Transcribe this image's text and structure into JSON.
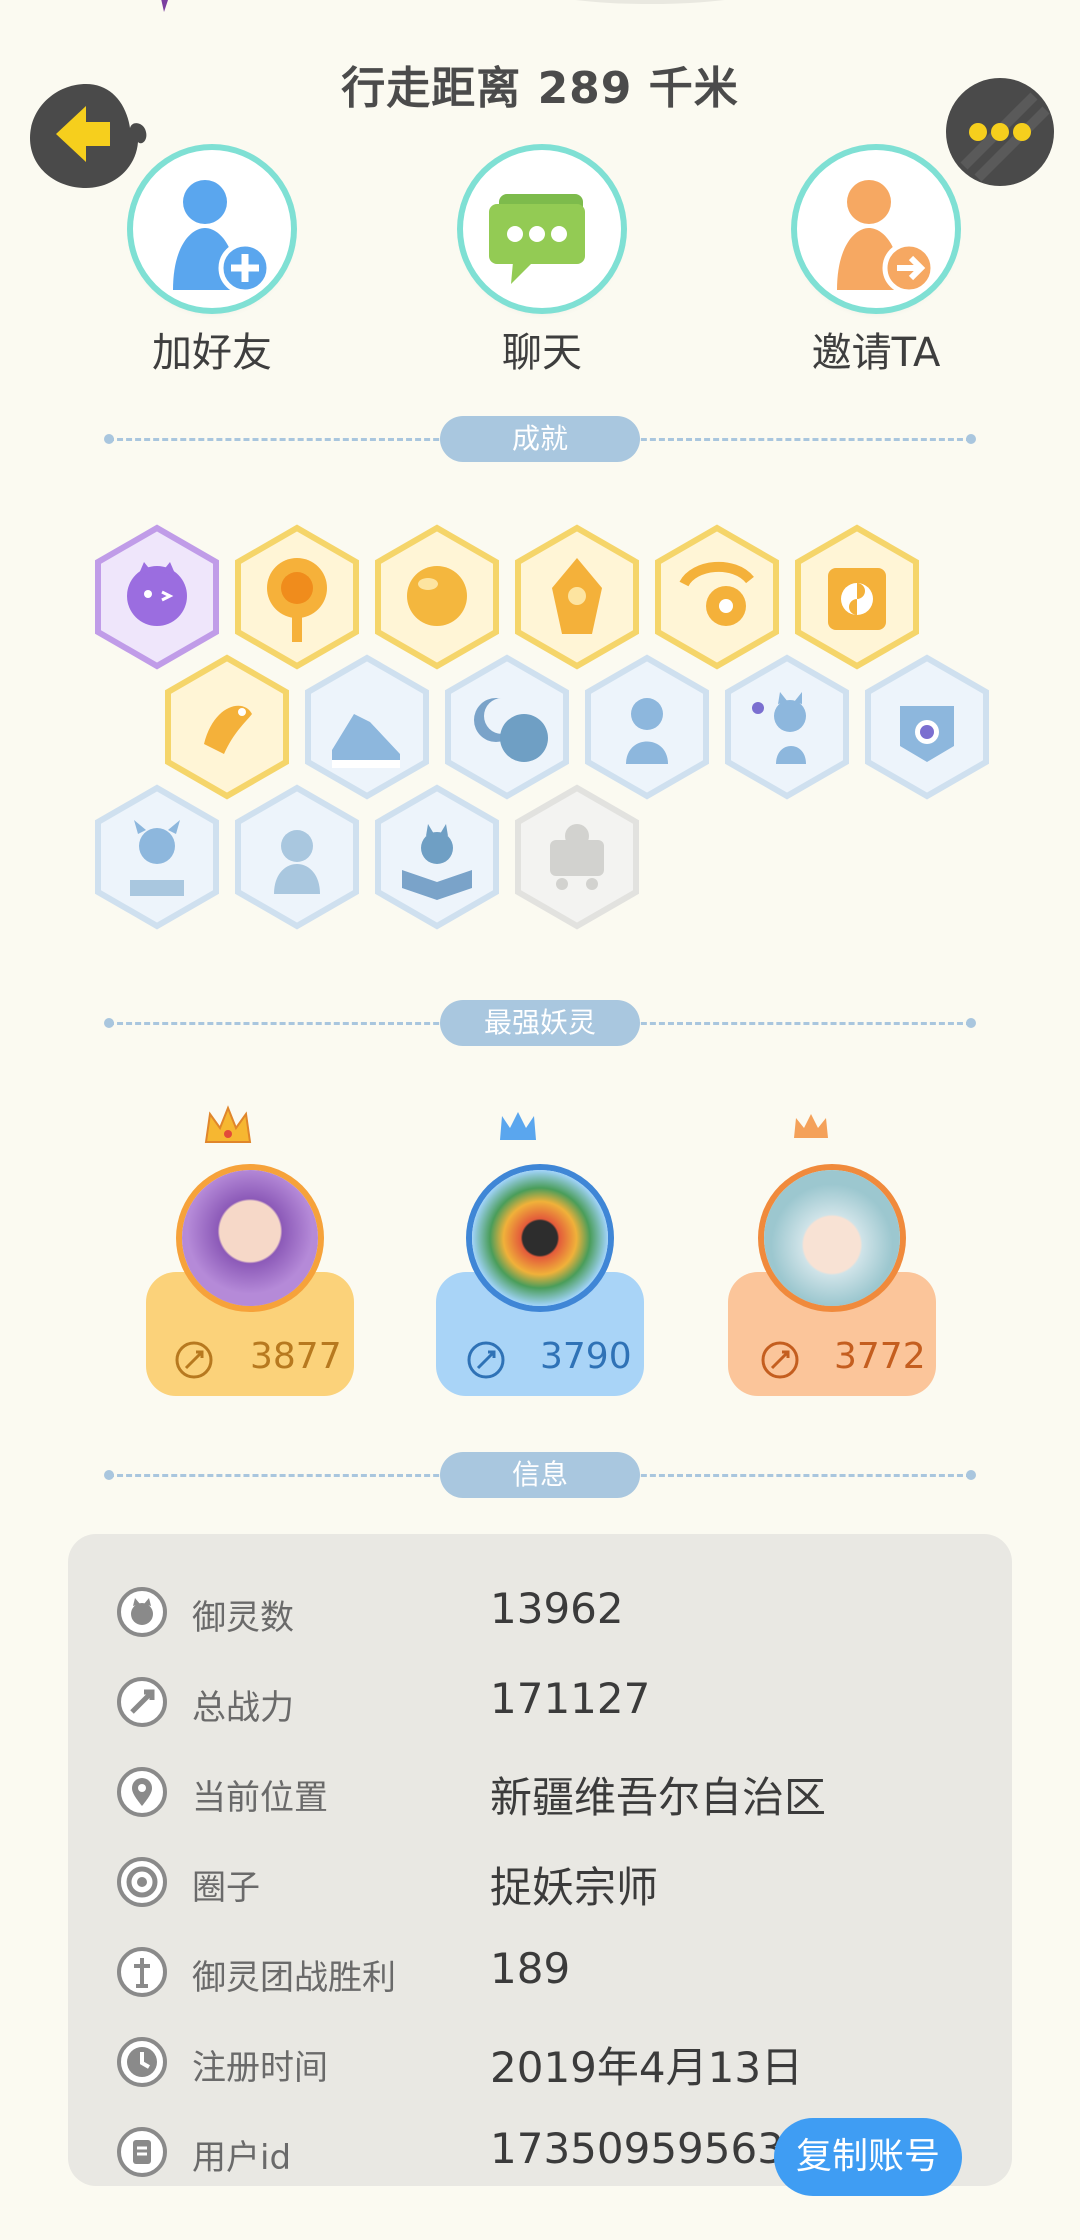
{
  "header": {
    "distance_label": "行走距离 289 千米"
  },
  "actions": [
    {
      "label": "加好友",
      "icon": "add-friend-icon"
    },
    {
      "label": "聊天",
      "icon": "chat-icon"
    },
    {
      "label": "邀请TA",
      "icon": "invite-icon"
    }
  ],
  "sections": {
    "achievements": "成就",
    "strongest": "最强妖灵",
    "info": "信息"
  },
  "spirits": [
    {
      "power": "3877",
      "card_color": "#fbd27a",
      "text_color": "#b7791f"
    },
    {
      "power": "3790",
      "card_color": "#a9d4f7",
      "text_color": "#2f72b6"
    },
    {
      "power": "3772",
      "card_color": "#fbc59a",
      "text_color": "#c45e1f"
    }
  ],
  "info": {
    "rows": [
      {
        "label": "御灵数",
        "value": "13962",
        "icon": "spirit-count-icon"
      },
      {
        "label": "总战力",
        "value": "171127",
        "icon": "battle-power-icon"
      },
      {
        "label": "当前位置",
        "value": "新疆维吾尔自治区",
        "icon": "location-pin-icon"
      },
      {
        "label": "圈子",
        "value": "捉妖宗师",
        "icon": "circle-icon"
      },
      {
        "label": "御灵团战胜利",
        "value": "189",
        "icon": "team-battle-icon"
      },
      {
        "label": "注册时间",
        "value": "2019年4月13日",
        "icon": "clock-icon"
      },
      {
        "label": "用户id",
        "value": "17350959563",
        "icon": "user-id-icon"
      }
    ],
    "copy_button": "复制账号"
  },
  "colors": {
    "background": "#fbfaf1",
    "section_pill": "#a9c7df",
    "accent_blue": "#3f9df3",
    "panel": "#e9e8e3"
  }
}
